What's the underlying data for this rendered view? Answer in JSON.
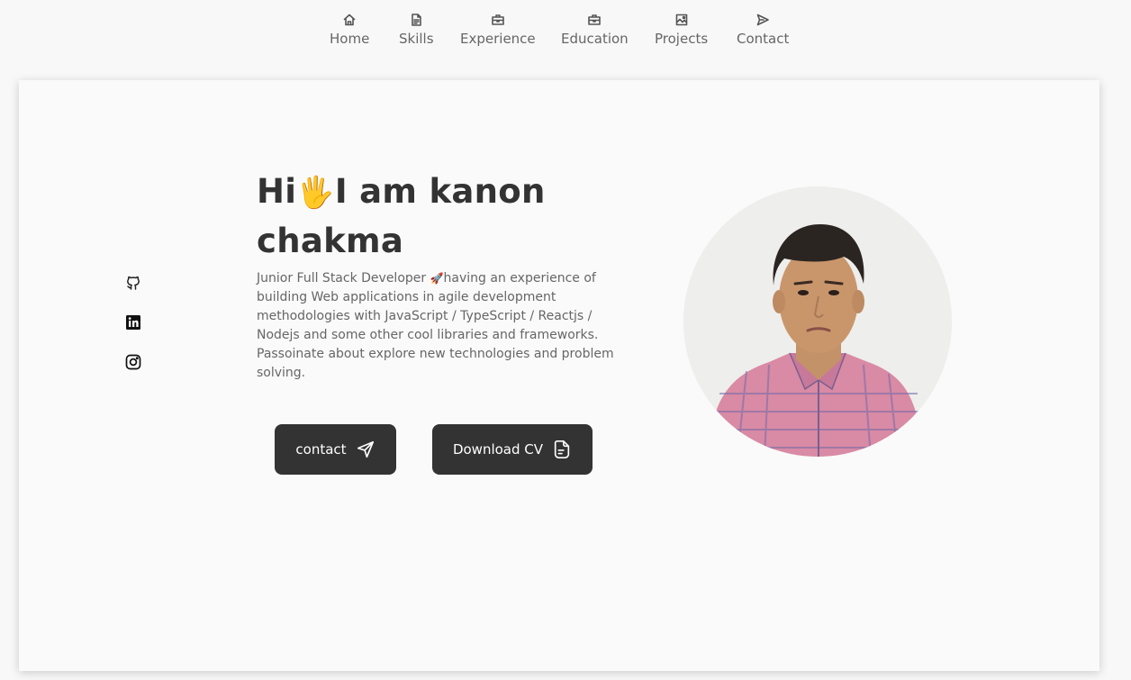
{
  "nav": {
    "items": [
      {
        "label": "Home",
        "icon": "home-icon"
      },
      {
        "label": "Skills",
        "icon": "document-icon"
      },
      {
        "label": "Experience",
        "icon": "briefcase-icon"
      },
      {
        "label": "Education",
        "icon": "briefcase-icon"
      },
      {
        "label": "Projects",
        "icon": "image-icon"
      },
      {
        "label": "Contact",
        "icon": "send-icon"
      }
    ]
  },
  "hero": {
    "greeting": "Hi",
    "wave": "🖐",
    "name_line1": "I am kanon",
    "name_line2": "chakma",
    "description_part1": "Junior Full Stack Developer ",
    "rocket": "🚀",
    "description_part2": "having an experience of building Web applications in agile development methodologies with JavaScript / TypeScript / Reactjs / Nodejs and some other cool libraries and frameworks. Passoinate about explore new technologies and problem solving.",
    "contact_button": "contact",
    "cv_button": "Download CV"
  },
  "socials": [
    {
      "icon": "github-icon"
    },
    {
      "icon": "linkedin-icon"
    },
    {
      "icon": "instagram-icon"
    }
  ],
  "colors": {
    "button_bg": "#333333",
    "page_bg": "#f8f8f8",
    "text_dark": "#333333",
    "text_muted": "#666666"
  }
}
